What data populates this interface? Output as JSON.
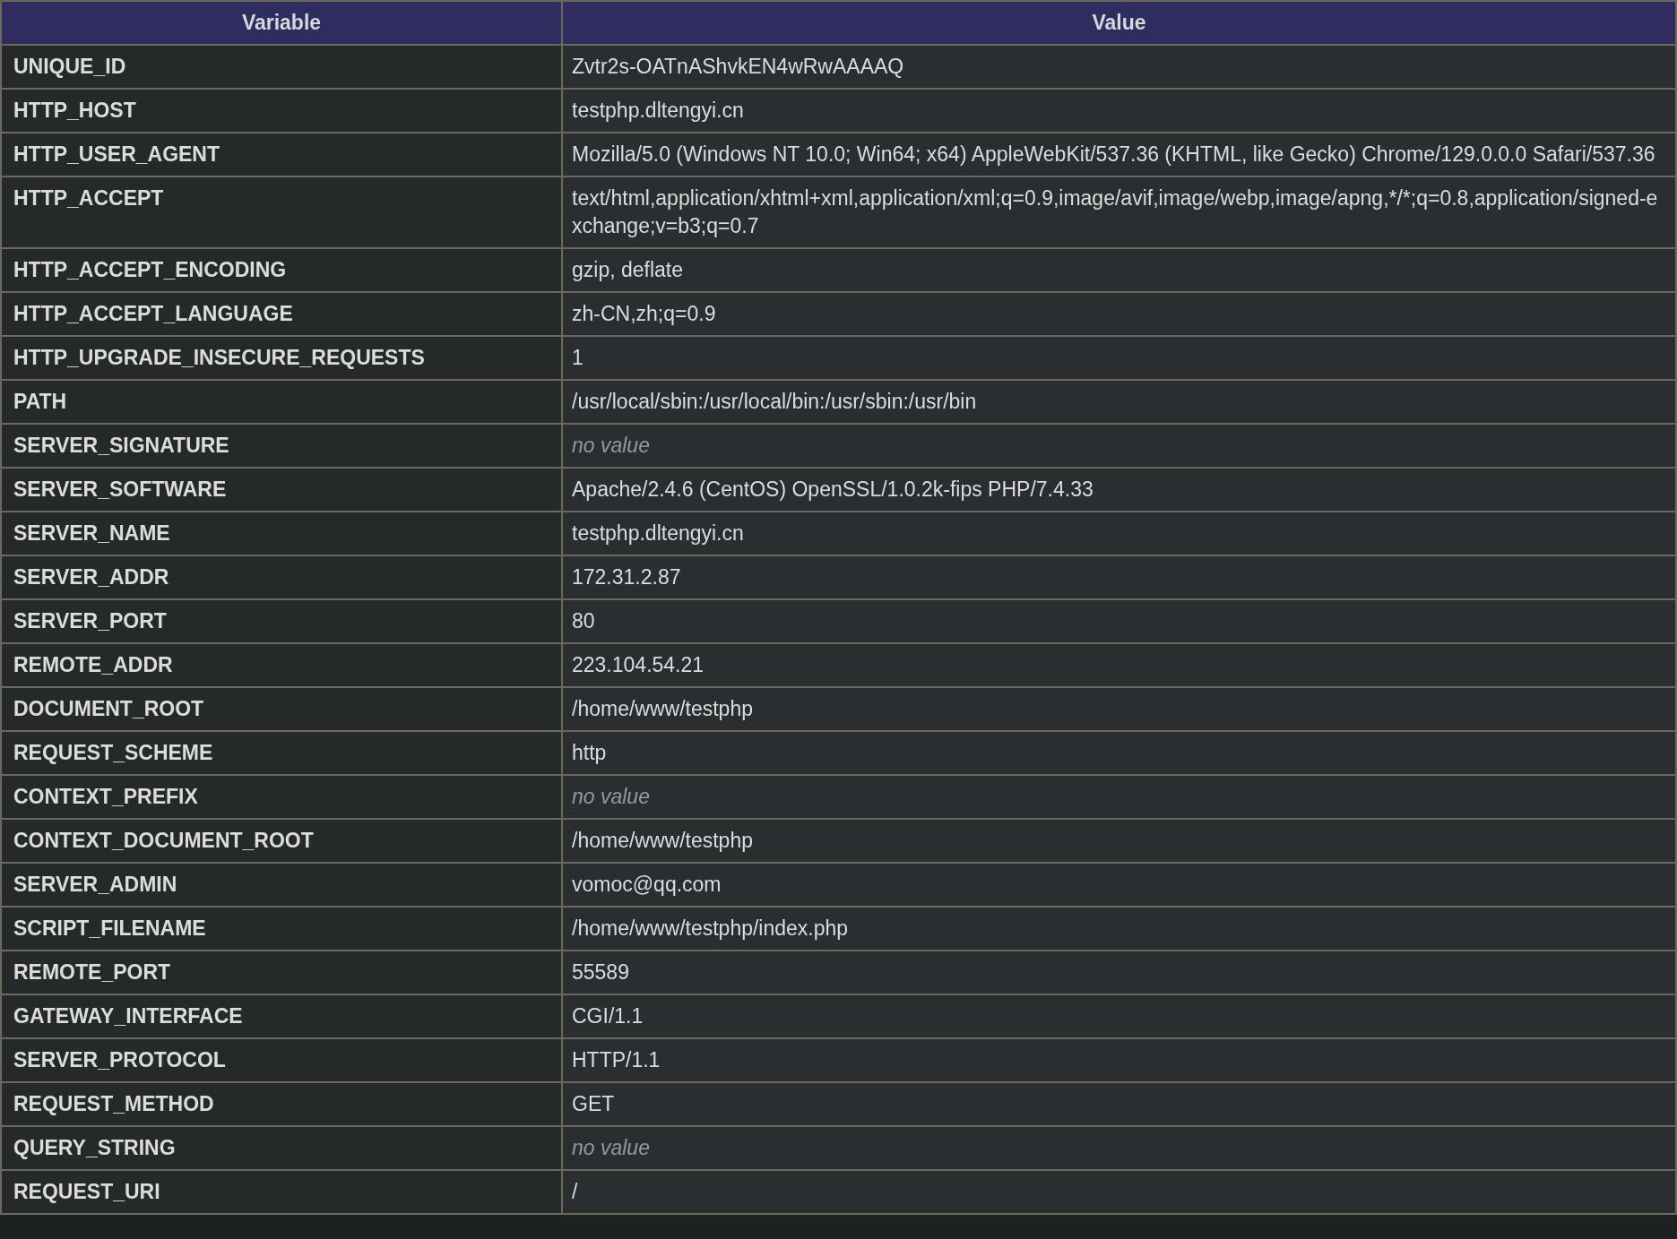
{
  "table": {
    "columns": [
      "Variable",
      "Value"
    ],
    "rows": [
      {
        "variable": "UNIQUE_ID",
        "value": "Zvtr2s-OATnAShvkEN4wRwAAAAQ",
        "kind": "text"
      },
      {
        "variable": "HTTP_HOST",
        "value": "testphp.dltengyi.cn",
        "kind": "text"
      },
      {
        "variable": "HTTP_USER_AGENT",
        "value": "Mozilla/5.0 (Windows NT 10.0; Win64; x64) AppleWebKit/537.36 (KHTML, like Gecko) Chrome/129.0.0.0 Safari/537.36",
        "kind": "text"
      },
      {
        "variable": "HTTP_ACCEPT",
        "value": "text/html,application/xhtml+xml,application/xml;q=0.9,image/avif,image/webp,image/apng,*/*;q=0.8,application/signed-exchange;v=b3;q=0.7",
        "kind": "text"
      },
      {
        "variable": "HTTP_ACCEPT_ENCODING",
        "value": "gzip, deflate",
        "kind": "text"
      },
      {
        "variable": "HTTP_ACCEPT_LANGUAGE",
        "value": "zh-CN,zh;q=0.9",
        "kind": "text"
      },
      {
        "variable": "HTTP_UPGRADE_INSECURE_REQUESTS",
        "value": "1",
        "kind": "text"
      },
      {
        "variable": "PATH",
        "value": "/usr/local/sbin:/usr/local/bin:/usr/sbin:/usr/bin",
        "kind": "text"
      },
      {
        "variable": "SERVER_SIGNATURE",
        "value": "no value",
        "kind": "no-value"
      },
      {
        "variable": "SERVER_SOFTWARE",
        "value": "Apache/2.4.6 (CentOS) OpenSSL/1.0.2k-fips PHP/7.4.33",
        "kind": "text"
      },
      {
        "variable": "SERVER_NAME",
        "value": "testphp.dltengyi.cn",
        "kind": "text"
      },
      {
        "variable": "SERVER_ADDR",
        "value": "172.31.2.87",
        "kind": "text"
      },
      {
        "variable": "SERVER_PORT",
        "value": "80",
        "kind": "text"
      },
      {
        "variable": "REMOTE_ADDR",
        "value": "223.104.54.21",
        "kind": "text"
      },
      {
        "variable": "DOCUMENT_ROOT",
        "value": "/home/www/testphp",
        "kind": "text"
      },
      {
        "variable": "REQUEST_SCHEME",
        "value": "http",
        "kind": "text"
      },
      {
        "variable": "CONTEXT_PREFIX",
        "value": "no value",
        "kind": "no-value"
      },
      {
        "variable": "CONTEXT_DOCUMENT_ROOT",
        "value": "/home/www/testphp",
        "kind": "text"
      },
      {
        "variable": "SERVER_ADMIN",
        "value": "vomoc@qq.com",
        "kind": "text"
      },
      {
        "variable": "SCRIPT_FILENAME",
        "value": "/home/www/testphp/index.php",
        "kind": "text"
      },
      {
        "variable": "REMOTE_PORT",
        "value": "55589",
        "kind": "text"
      },
      {
        "variable": "GATEWAY_INTERFACE",
        "value": "CGI/1.1",
        "kind": "text"
      },
      {
        "variable": "SERVER_PROTOCOL",
        "value": "HTTP/1.1",
        "kind": "text"
      },
      {
        "variable": "REQUEST_METHOD",
        "value": "GET",
        "kind": "text"
      },
      {
        "variable": "QUERY_STRING",
        "value": "no value",
        "kind": "no-value"
      },
      {
        "variable": "REQUEST_URI",
        "value": "/",
        "kind": "text"
      }
    ]
  }
}
